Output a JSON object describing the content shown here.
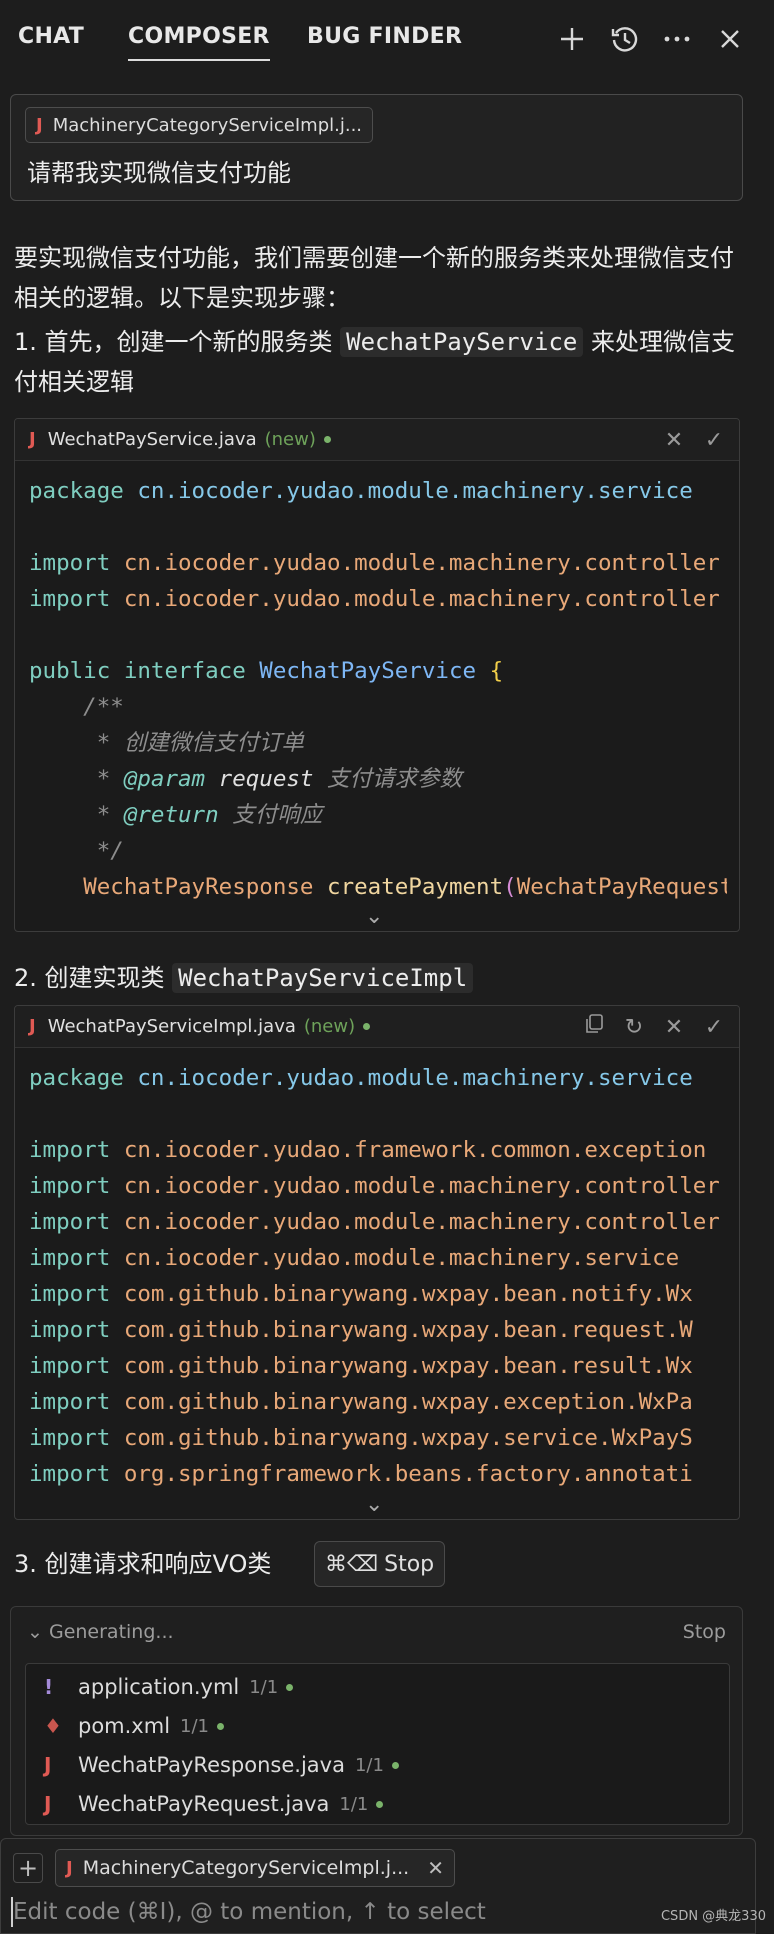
{
  "tabs": [
    "CHAT",
    "COMPOSER",
    "BUG FINDER"
  ],
  "active_tab": "COMPOSER",
  "top_icons": [
    "plus-icon",
    "history-icon",
    "more-icon",
    "close-icon"
  ],
  "prompt": {
    "context_chip": "MachineryCategoryServiceImpl.j...",
    "text": "请帮我实现微信支付功能"
  },
  "answer": {
    "intro": "要实现微信支付功能，我们需要创建一个新的服务类来处理微信支付相关的逻辑。以下是实现步骤：",
    "step1_prefix": "1. 首先，创建一个新的服务类 ",
    "step1_code": "WechatPayService",
    "step1_suffix": " 来处理微信支付相关逻辑",
    "step2_prefix": "2. 创建实现类 ",
    "step2_code": "WechatPayServiceImpl",
    "step3": "3. 创建请求和响应VO类"
  },
  "code_block_1": {
    "filename": "WechatPayService.java",
    "status": "(new)",
    "lines": {
      "l1_kw": "package",
      "l1_rest": " cn.iocoder.yudao.module.machinery.service",
      "l2_kw": "import",
      "l2_rest": " cn.iocoder.yudao.module.machinery.controller",
      "l3_kw": "import",
      "l3_rest": " cn.iocoder.yudao.module.machinery.controller",
      "l4_kw1": "public",
      "l4_kw2": "interface",
      "l4_cls": "WechatPayService",
      "l4_brace": "{",
      "l5": "    /**",
      "l6": "     * 创建微信支付订单",
      "l7_star": "     * ",
      "l7_tag": "@param",
      "l7_name": "request",
      "l7_desc": " 支付请求参数",
      "l8_star": "     * ",
      "l8_tag": "@return",
      "l8_desc": " 支付响应",
      "l9": "     */",
      "l10_type": "WechatPayResponse",
      "l10_fn": "createPayment",
      "l10_paren": "(",
      "l10_arg": "WechatPayRequest"
    }
  },
  "code_block_2": {
    "filename": "WechatPayServiceImpl.java",
    "status": "(new)",
    "package_kw": "package",
    "package_rest": " cn.iocoder.yudao.module.machinery.service",
    "import_kw": "import",
    "imports": [
      " cn.iocoder.yudao.framework.common.exception",
      " cn.iocoder.yudao.module.machinery.controller",
      " cn.iocoder.yudao.module.machinery.controller",
      " cn.iocoder.yudao.module.machinery.service",
      " com.github.binarywang.wxpay.bean.notify.Wx",
      " com.github.binarywang.wxpay.bean.request.W",
      " com.github.binarywang.wxpay.bean.result.Wx",
      " com.github.binarywang.wxpay.exception.WxPa",
      " com.github.binarywang.wxpay.service.WxPayS",
      " org.springframework.beans.factory.annotati"
    ]
  },
  "stop_button": {
    "shortcut": "⌘⌫",
    "label": "Stop"
  },
  "generating": {
    "label": "Generating...",
    "stop": "Stop",
    "files": [
      {
        "icon": "!",
        "name": "application.yml",
        "count": "1/1",
        "color": "#a58bd9"
      },
      {
        "icon": "♦",
        "name": "pom.xml",
        "count": "1/1",
        "color": "#c9564e"
      },
      {
        "icon": "J",
        "name": "WechatPayResponse.java",
        "count": "1/1",
        "color": "#e05a54"
      },
      {
        "icon": "J",
        "name": "WechatPayRequest.java",
        "count": "1/1",
        "color": "#e05a54"
      }
    ]
  },
  "input": {
    "plus": "+",
    "context_chip": "MachineryCategoryServiceImpl.j...",
    "chip_close": "✕",
    "placeholder": "Edit code (⌘I), @ to mention, ↑ to select"
  },
  "watermark": "CSDN @典龙330"
}
